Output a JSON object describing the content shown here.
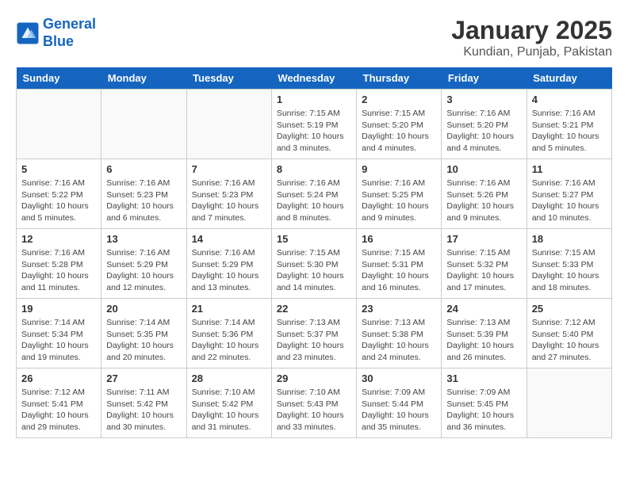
{
  "header": {
    "logo_line1": "General",
    "logo_line2": "Blue",
    "title": "January 2025",
    "subtitle": "Kundian, Punjab, Pakistan"
  },
  "days_of_week": [
    "Sunday",
    "Monday",
    "Tuesday",
    "Wednesday",
    "Thursday",
    "Friday",
    "Saturday"
  ],
  "weeks": [
    [
      {
        "day": "",
        "info": ""
      },
      {
        "day": "",
        "info": ""
      },
      {
        "day": "",
        "info": ""
      },
      {
        "day": "1",
        "info": "Sunrise: 7:15 AM\nSunset: 5:19 PM\nDaylight: 10 hours\nand 3 minutes."
      },
      {
        "day": "2",
        "info": "Sunrise: 7:15 AM\nSunset: 5:20 PM\nDaylight: 10 hours\nand 4 minutes."
      },
      {
        "day": "3",
        "info": "Sunrise: 7:16 AM\nSunset: 5:20 PM\nDaylight: 10 hours\nand 4 minutes."
      },
      {
        "day": "4",
        "info": "Sunrise: 7:16 AM\nSunset: 5:21 PM\nDaylight: 10 hours\nand 5 minutes."
      }
    ],
    [
      {
        "day": "5",
        "info": "Sunrise: 7:16 AM\nSunset: 5:22 PM\nDaylight: 10 hours\nand 5 minutes."
      },
      {
        "day": "6",
        "info": "Sunrise: 7:16 AM\nSunset: 5:23 PM\nDaylight: 10 hours\nand 6 minutes."
      },
      {
        "day": "7",
        "info": "Sunrise: 7:16 AM\nSunset: 5:23 PM\nDaylight: 10 hours\nand 7 minutes."
      },
      {
        "day": "8",
        "info": "Sunrise: 7:16 AM\nSunset: 5:24 PM\nDaylight: 10 hours\nand 8 minutes."
      },
      {
        "day": "9",
        "info": "Sunrise: 7:16 AM\nSunset: 5:25 PM\nDaylight: 10 hours\nand 9 minutes."
      },
      {
        "day": "10",
        "info": "Sunrise: 7:16 AM\nSunset: 5:26 PM\nDaylight: 10 hours\nand 9 minutes."
      },
      {
        "day": "11",
        "info": "Sunrise: 7:16 AM\nSunset: 5:27 PM\nDaylight: 10 hours\nand 10 minutes."
      }
    ],
    [
      {
        "day": "12",
        "info": "Sunrise: 7:16 AM\nSunset: 5:28 PM\nDaylight: 10 hours\nand 11 minutes."
      },
      {
        "day": "13",
        "info": "Sunrise: 7:16 AM\nSunset: 5:29 PM\nDaylight: 10 hours\nand 12 minutes."
      },
      {
        "day": "14",
        "info": "Sunrise: 7:16 AM\nSunset: 5:29 PM\nDaylight: 10 hours\nand 13 minutes."
      },
      {
        "day": "15",
        "info": "Sunrise: 7:15 AM\nSunset: 5:30 PM\nDaylight: 10 hours\nand 14 minutes."
      },
      {
        "day": "16",
        "info": "Sunrise: 7:15 AM\nSunset: 5:31 PM\nDaylight: 10 hours\nand 16 minutes."
      },
      {
        "day": "17",
        "info": "Sunrise: 7:15 AM\nSunset: 5:32 PM\nDaylight: 10 hours\nand 17 minutes."
      },
      {
        "day": "18",
        "info": "Sunrise: 7:15 AM\nSunset: 5:33 PM\nDaylight: 10 hours\nand 18 minutes."
      }
    ],
    [
      {
        "day": "19",
        "info": "Sunrise: 7:14 AM\nSunset: 5:34 PM\nDaylight: 10 hours\nand 19 minutes."
      },
      {
        "day": "20",
        "info": "Sunrise: 7:14 AM\nSunset: 5:35 PM\nDaylight: 10 hours\nand 20 minutes."
      },
      {
        "day": "21",
        "info": "Sunrise: 7:14 AM\nSunset: 5:36 PM\nDaylight: 10 hours\nand 22 minutes."
      },
      {
        "day": "22",
        "info": "Sunrise: 7:13 AM\nSunset: 5:37 PM\nDaylight: 10 hours\nand 23 minutes."
      },
      {
        "day": "23",
        "info": "Sunrise: 7:13 AM\nSunset: 5:38 PM\nDaylight: 10 hours\nand 24 minutes."
      },
      {
        "day": "24",
        "info": "Sunrise: 7:13 AM\nSunset: 5:39 PM\nDaylight: 10 hours\nand 26 minutes."
      },
      {
        "day": "25",
        "info": "Sunrise: 7:12 AM\nSunset: 5:40 PM\nDaylight: 10 hours\nand 27 minutes."
      }
    ],
    [
      {
        "day": "26",
        "info": "Sunrise: 7:12 AM\nSunset: 5:41 PM\nDaylight: 10 hours\nand 29 minutes."
      },
      {
        "day": "27",
        "info": "Sunrise: 7:11 AM\nSunset: 5:42 PM\nDaylight: 10 hours\nand 30 minutes."
      },
      {
        "day": "28",
        "info": "Sunrise: 7:10 AM\nSunset: 5:42 PM\nDaylight: 10 hours\nand 31 minutes."
      },
      {
        "day": "29",
        "info": "Sunrise: 7:10 AM\nSunset: 5:43 PM\nDaylight: 10 hours\nand 33 minutes."
      },
      {
        "day": "30",
        "info": "Sunrise: 7:09 AM\nSunset: 5:44 PM\nDaylight: 10 hours\nand 35 minutes."
      },
      {
        "day": "31",
        "info": "Sunrise: 7:09 AM\nSunset: 5:45 PM\nDaylight: 10 hours\nand 36 minutes."
      },
      {
        "day": "",
        "info": ""
      }
    ]
  ]
}
